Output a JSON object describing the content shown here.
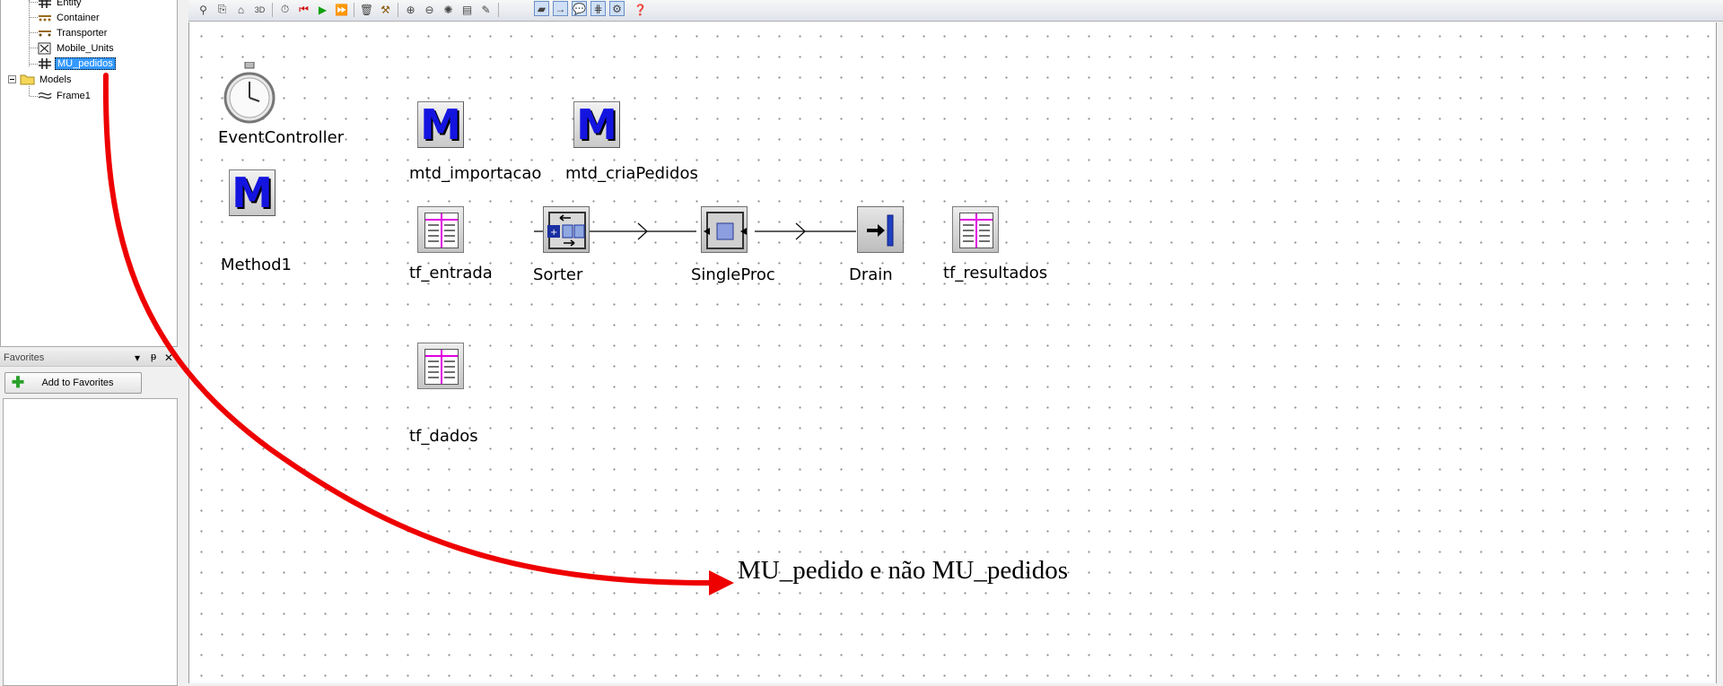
{
  "class_tree": {
    "items": [
      {
        "label": "Entity",
        "icon": "entity-grid-icon"
      },
      {
        "label": "Container",
        "icon": "container-icon"
      },
      {
        "label": "Transporter",
        "icon": "transporter-icon"
      },
      {
        "label": "Mobile_Units",
        "icon": "mobile-units-icon"
      },
      {
        "label": "MU_pedidos",
        "icon": "entity-grid-icon",
        "selected": true
      },
      {
        "label": "Models",
        "icon": "folder-icon"
      },
      {
        "label": "Frame1",
        "icon": "frame-icon"
      }
    ]
  },
  "favorites": {
    "title": "Favorites",
    "add_button_label": "Add to Favorites"
  },
  "frame": {
    "objects": {
      "event_controller": "EventController",
      "method1": "Method1",
      "mtd_importacao": "mtd_importacao",
      "mtd_criaPedidos": "mtd_criaPedidos",
      "tf_entrada": "tf_entrada",
      "sorter": "Sorter",
      "singleproc": "SingleProc",
      "drain": "Drain",
      "tf_resultados": "tf_resultados",
      "tf_dados": "tf_dados"
    }
  },
  "annotation": {
    "text": "MU_pedido e não MU_pedidos",
    "arrow_color": "#ee0000"
  },
  "colors": {
    "method_icon_blue": "#1414e0",
    "selection_blue": "#3399ff",
    "table_header_magenta": "#e000e0"
  }
}
